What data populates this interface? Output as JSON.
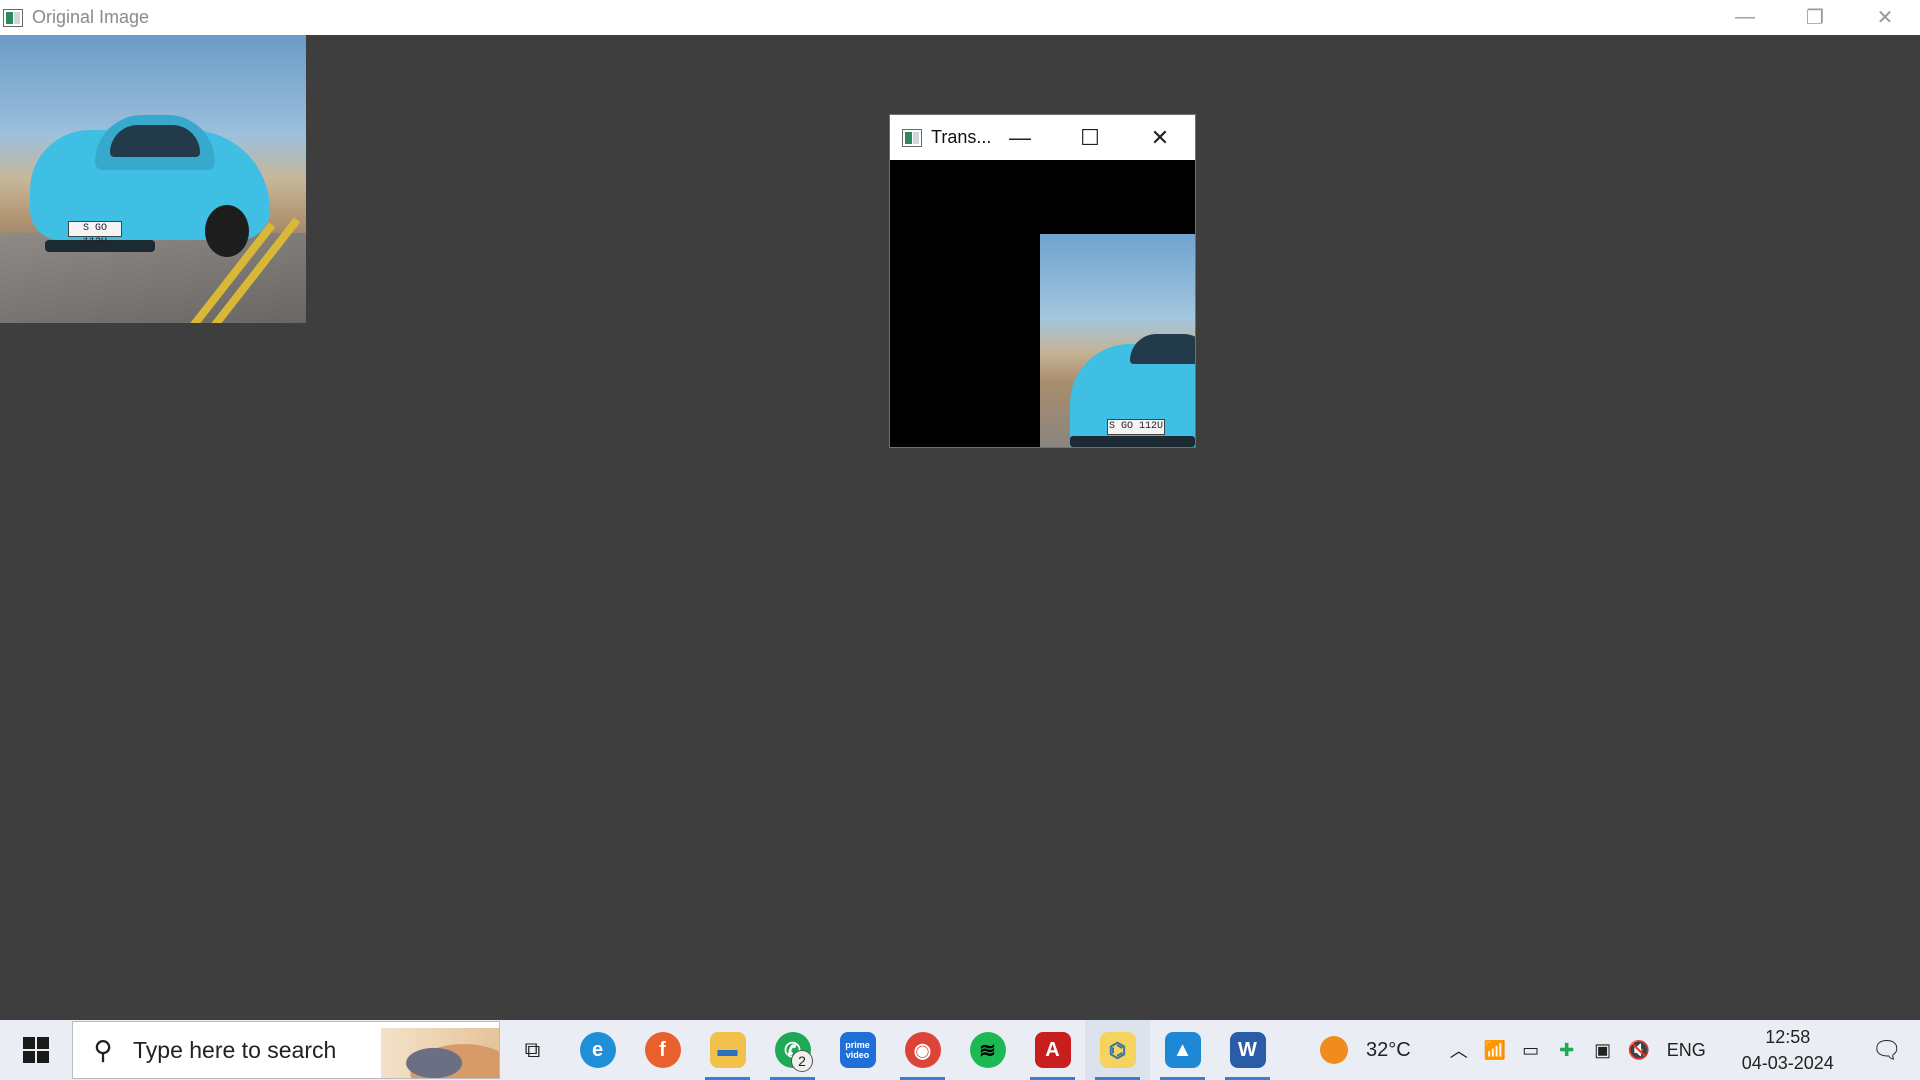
{
  "main_window": {
    "title": "Original Image",
    "controls": {
      "minimize": "—",
      "restore": "❐",
      "close": "✕"
    }
  },
  "original_image": {
    "plate_text": "S GO 112U"
  },
  "trans_window": {
    "title": "Trans...",
    "controls": {
      "minimize": "—",
      "maximize": "☐",
      "close": "✕"
    },
    "plate_text": "S GO 112U"
  },
  "taskbar": {
    "search_placeholder": "Type here to search",
    "apps": [
      {
        "name": "task-view",
        "glyph": "▯▯",
        "color": "#eaeef4"
      },
      {
        "name": "edge",
        "glyph": "e",
        "color": "#1f8fd8"
      },
      {
        "name": "firefox",
        "glyph": "f",
        "color": "#e8612c"
      },
      {
        "name": "file-explorer",
        "glyph": "▬",
        "color": "#f2c14b"
      },
      {
        "name": "whatsapp",
        "glyph": "✆",
        "color": "#1fa855",
        "badge": "2"
      },
      {
        "name": "prime-video",
        "glyph": "prime video",
        "color": "#1f6fd6"
      },
      {
        "name": "chrome",
        "glyph": "◉",
        "color": "#db4437"
      },
      {
        "name": "spotify",
        "glyph": "≋",
        "color": "#1db954"
      },
      {
        "name": "acrobat",
        "glyph": "A",
        "color": "#c81e1e"
      },
      {
        "name": "python",
        "glyph": "⌬",
        "color": "#f4d35e"
      },
      {
        "name": "photos",
        "glyph": "▲",
        "color": "#1f88d6"
      },
      {
        "name": "word",
        "glyph": "W",
        "color": "#2b5ca8"
      }
    ],
    "weather_temp": "32°C",
    "language": "ENG",
    "time": "12:58",
    "date": "04-03-2024"
  }
}
